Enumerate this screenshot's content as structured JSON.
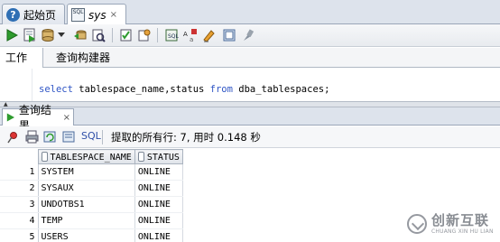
{
  "doc_tabs": [
    {
      "label": "起始页",
      "icon": "help-icon"
    },
    {
      "label": "sys",
      "icon": "sql-worksheet-icon"
    }
  ],
  "sql_icon_text": "SQL",
  "toolbar": {
    "icons": [
      "run-statement-icon",
      "run-script-icon",
      "commit-icon",
      "rollback-icon",
      "explain-plan-icon",
      "autotrace-icon",
      "sql-tuning-icon",
      "unshared-sql-icon",
      "to-upper-icon",
      "clear-icon",
      "history-icon",
      "format-icon"
    ]
  },
  "subtabs": {
    "worksheet": "工作表",
    "query_builder": "查询构建器"
  },
  "editor": {
    "kw_select": "select",
    "columns": " tablespace_name,status ",
    "kw_from": "from",
    "table": " dba_tablespaces;"
  },
  "result_tab": {
    "label": "查询结果",
    "close": "×"
  },
  "result_toolbar": {
    "sql_label": "SQL",
    "status": "提取的所有行: 7, 用时 0.148 秒"
  },
  "grid": {
    "columns": [
      "TABLESPACE_NAME",
      "STATUS"
    ],
    "rows": [
      {
        "n": "1",
        "name": "SYSTEM",
        "status": "ONLINE"
      },
      {
        "n": "2",
        "name": "SYSAUX",
        "status": "ONLINE"
      },
      {
        "n": "3",
        "name": "UNDOTBS1",
        "status": "ONLINE"
      },
      {
        "n": "4",
        "name": "TEMP",
        "status": "ONLINE"
      },
      {
        "n": "5",
        "name": "USERS",
        "status": "ONLINE"
      }
    ]
  },
  "watermark": {
    "main": "创新互联",
    "sub": "CHUANG XIN HU LIAN"
  },
  "colors": {
    "keyword": "#2f55c5",
    "run_green": "#2e9b2e"
  }
}
